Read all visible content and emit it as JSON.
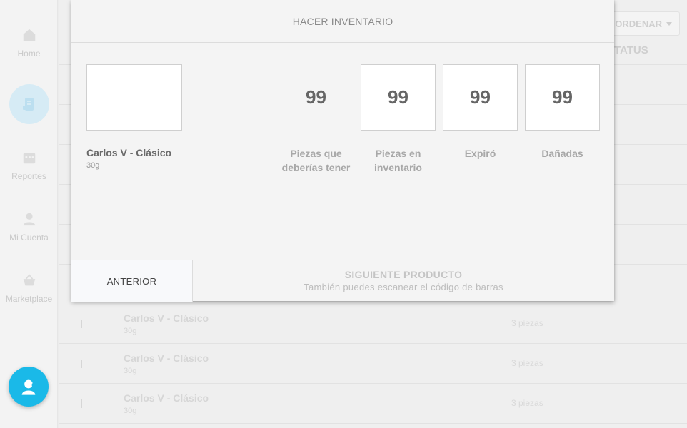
{
  "sidebar": {
    "items": [
      {
        "label": "Home",
        "icon": "home-icon"
      },
      {
        "label": "",
        "icon": "receipt-icon"
      },
      {
        "label": "Reportes",
        "icon": "calendar-icon"
      },
      {
        "label": "Mi Cuenta",
        "icon": "user-icon"
      },
      {
        "label": "Marketplace",
        "icon": "basket-icon"
      }
    ],
    "fab_icon": "support-agent-icon"
  },
  "background": {
    "sort_label": "ORDENAR",
    "status_header": "TATUS",
    "rows": [
      {
        "name": "Carlos V - Clásico",
        "weight": "30g",
        "qty": "3 piezas"
      },
      {
        "name": "Carlos V - Clásico",
        "weight": "30g",
        "qty": "3 piezas"
      },
      {
        "name": "Carlos V - Clásico",
        "weight": "30g",
        "qty": "3 piezas"
      }
    ]
  },
  "modal": {
    "title": "HACER INVENTARIO",
    "product": {
      "name": "Carlos V - Clásico",
      "weight": "30g"
    },
    "fields": [
      {
        "value": "99",
        "label": "Piezas que deberías tener",
        "editable": false
      },
      {
        "value": "99",
        "label": "Piezas en inventario",
        "editable": true
      },
      {
        "value": "99",
        "label": "Expiró",
        "editable": true
      },
      {
        "value": "99",
        "label": "Dañadas",
        "editable": true
      }
    ],
    "footer": {
      "prev_label": "ANTERIOR",
      "next_label": "SIGUIENTE PRODUCTO",
      "next_hint": "También puedes escanear el código de barras"
    }
  },
  "colors": {
    "accent": "#1ab9e8",
    "modal_bg": "#f4f4f4",
    "page_bg": "#efefef"
  }
}
